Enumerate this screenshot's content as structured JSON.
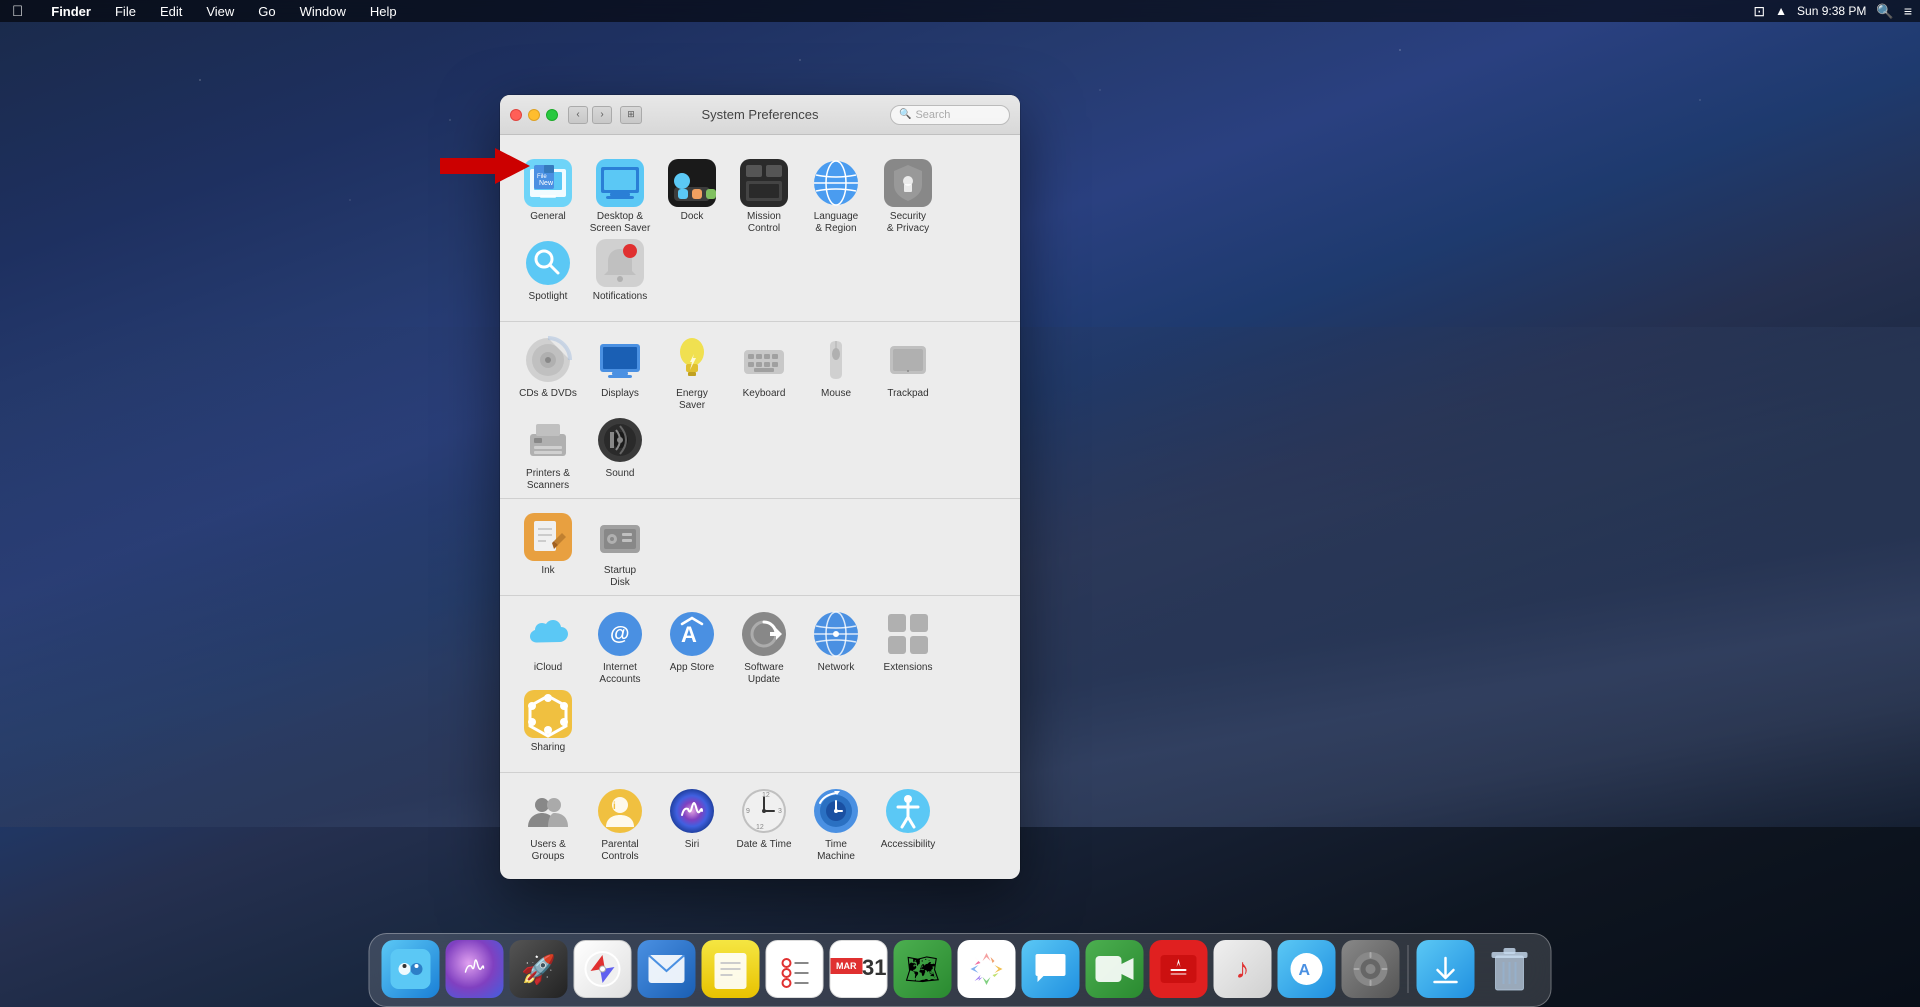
{
  "desktop": {
    "background_description": "macOS Mojave desert dune dark blue night"
  },
  "menubar": {
    "apple_label": "",
    "items": [
      "Finder",
      "File",
      "Edit",
      "View",
      "Go",
      "Window",
      "Help"
    ],
    "right_items": [
      "Sun 9:38 PM"
    ],
    "time": "Sun 9:38 PM"
  },
  "window": {
    "title": "System Preferences",
    "search_placeholder": "Search",
    "sections": [
      {
        "id": "personal",
        "items": [
          {
            "id": "general",
            "label": "General",
            "icon": "🖥"
          },
          {
            "id": "desktop",
            "label": "Desktop &\nScreen Saver",
            "icon": "🖥"
          },
          {
            "id": "dock",
            "label": "Dock",
            "icon": "⬛"
          },
          {
            "id": "mission",
            "label": "Mission\nControl",
            "icon": "⬛"
          },
          {
            "id": "language",
            "label": "Language\n& Region",
            "icon": "🌐"
          },
          {
            "id": "security",
            "label": "Security\n& Privacy",
            "icon": "🔒"
          },
          {
            "id": "spotlight",
            "label": "Spotlight",
            "icon": "🔍"
          },
          {
            "id": "notifications",
            "label": "Notifications",
            "icon": "🔴"
          }
        ]
      },
      {
        "id": "hardware",
        "items": [
          {
            "id": "cds",
            "label": "CDs & DVDs",
            "icon": "💿"
          },
          {
            "id": "displays",
            "label": "Displays",
            "icon": "🖥"
          },
          {
            "id": "energy",
            "label": "Energy\nSaver",
            "icon": "💡"
          },
          {
            "id": "keyboard",
            "label": "Keyboard",
            "icon": "⌨"
          },
          {
            "id": "mouse",
            "label": "Mouse",
            "icon": "🖱"
          },
          {
            "id": "trackpad",
            "label": "Trackpad",
            "icon": "▭"
          },
          {
            "id": "printers",
            "label": "Printers &\nScanners",
            "icon": "🖨"
          },
          {
            "id": "sound",
            "label": "Sound",
            "icon": "🔊"
          }
        ]
      },
      {
        "id": "other_hardware",
        "items": [
          {
            "id": "ink",
            "label": "Ink",
            "icon": "✏"
          },
          {
            "id": "startup",
            "label": "Startup\nDisk",
            "icon": "💾"
          }
        ]
      },
      {
        "id": "internet",
        "items": [
          {
            "id": "icloud",
            "label": "iCloud",
            "icon": "☁"
          },
          {
            "id": "internet_accounts",
            "label": "Internet\nAccounts",
            "icon": "@"
          },
          {
            "id": "app_store",
            "label": "App Store",
            "icon": "A"
          },
          {
            "id": "software_update",
            "label": "Software\nUpdate",
            "icon": "⚙"
          },
          {
            "id": "network",
            "label": "Network",
            "icon": "🌐"
          },
          {
            "id": "extensions",
            "label": "Extensions",
            "icon": "▦"
          },
          {
            "id": "sharing",
            "label": "Sharing",
            "icon": "⬡"
          }
        ]
      },
      {
        "id": "system",
        "items": [
          {
            "id": "users",
            "label": "Users &\nGroups",
            "icon": "👥"
          },
          {
            "id": "parental",
            "label": "Parental\nControls",
            "icon": "👤"
          },
          {
            "id": "siri",
            "label": "Siri",
            "icon": "🎵"
          },
          {
            "id": "datetime",
            "label": "Date & Time",
            "icon": "🕐"
          },
          {
            "id": "timemachine",
            "label": "Time\nMachine",
            "icon": "🕐"
          },
          {
            "id": "accessibility",
            "label": "Accessibility",
            "icon": "♿"
          }
        ]
      }
    ]
  },
  "dock": {
    "items": [
      {
        "id": "finder",
        "label": "Finder",
        "icon": "😊",
        "color": "di-finder"
      },
      {
        "id": "siri",
        "label": "Siri",
        "icon": "◎",
        "color": "di-siri"
      },
      {
        "id": "launchpad",
        "label": "Launchpad",
        "icon": "🚀",
        "color": "di-launchpad"
      },
      {
        "id": "safari",
        "label": "Safari",
        "icon": "⊙",
        "color": "di-safari"
      },
      {
        "id": "mail",
        "label": "Mail",
        "icon": "✉",
        "color": "di-mail"
      },
      {
        "id": "notes",
        "label": "Notes",
        "icon": "📝",
        "color": "di-notes"
      },
      {
        "id": "reminders",
        "label": "Reminders",
        "icon": "☑",
        "color": "di-reminders"
      },
      {
        "id": "maps",
        "label": "Maps",
        "icon": "🗺",
        "color": "di-maps"
      },
      {
        "id": "photos",
        "label": "Photos",
        "icon": "⊕",
        "color": "di-photos"
      },
      {
        "id": "messages",
        "label": "Messages",
        "icon": "💬",
        "color": "di-messages"
      },
      {
        "id": "facetime",
        "label": "FaceTime",
        "icon": "📹",
        "color": "di-facetime"
      },
      {
        "id": "news",
        "label": "News",
        "icon": "⊘",
        "color": "di-news"
      },
      {
        "id": "music",
        "label": "Music",
        "icon": "♪",
        "color": "di-music"
      },
      {
        "id": "appstore",
        "label": "App Store",
        "icon": "A",
        "color": "di-appstore"
      },
      {
        "id": "syspref",
        "label": "System Preferences",
        "icon": "⚙",
        "color": "di-syspref"
      },
      {
        "id": "downloads",
        "label": "Downloads",
        "icon": "↓",
        "color": "di-downloads"
      },
      {
        "id": "trash",
        "label": "Trash",
        "icon": "🗑",
        "color": "di-trash"
      }
    ]
  },
  "arrow": {
    "direction": "right",
    "color": "#cc0000",
    "points_to": "general"
  }
}
